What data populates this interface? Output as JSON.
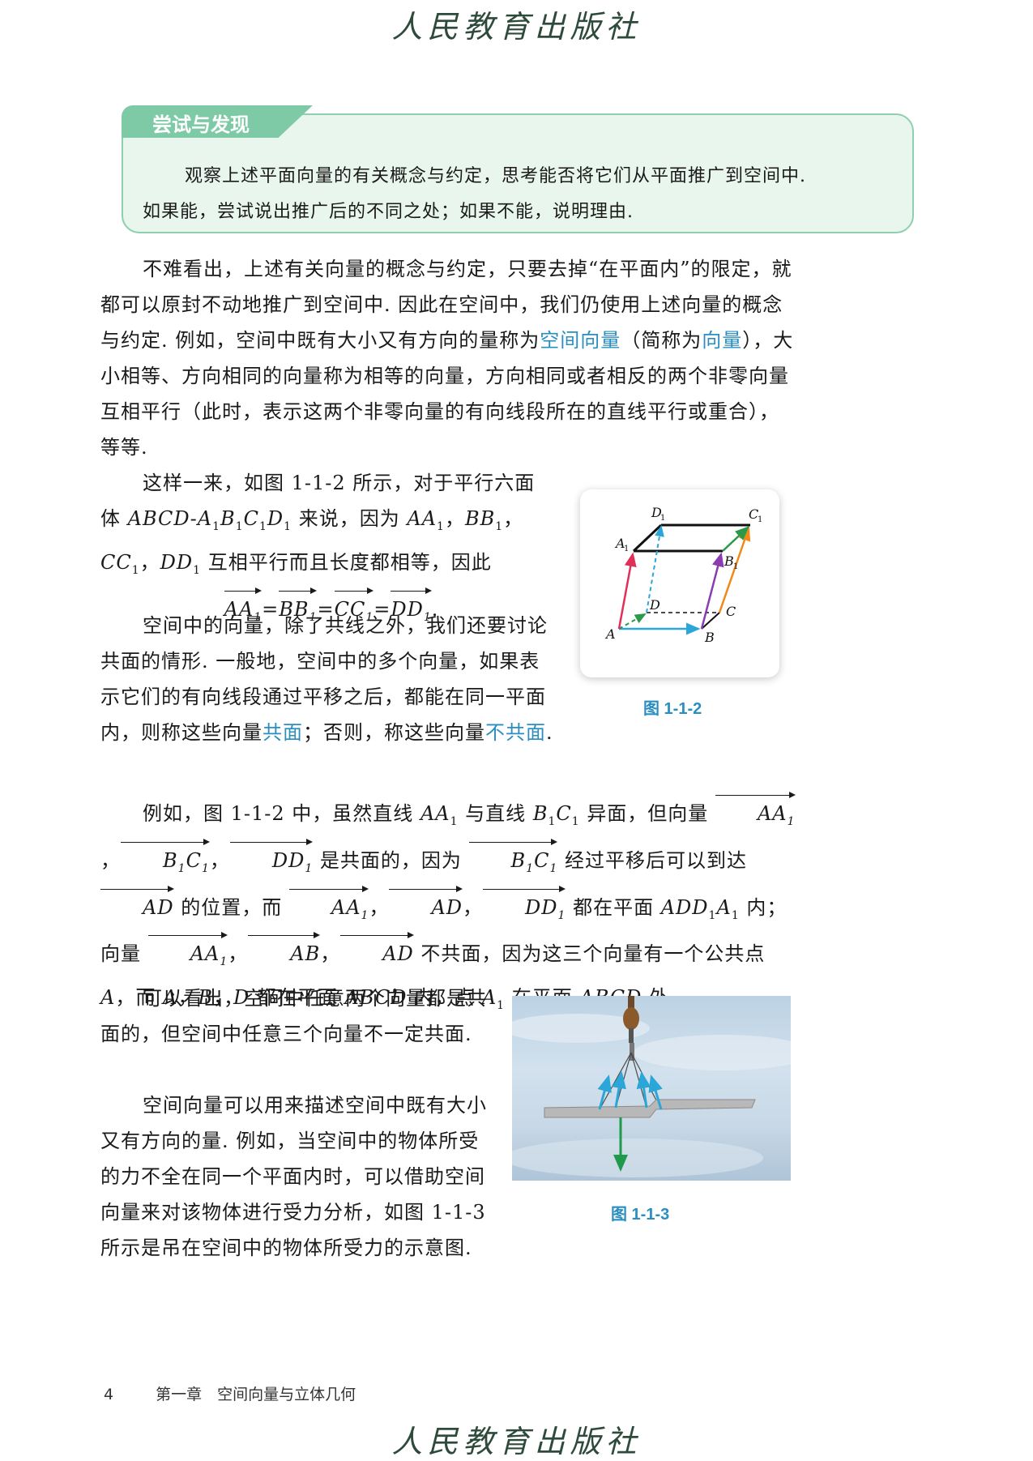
{
  "header": {
    "publisher": "人民教育出版社"
  },
  "tryout": {
    "title": "尝试与发现",
    "line1": "观察上述平面向量的有关概念与约定，思考能否将它们从平面推广到空间中.",
    "line2": "如果能，尝试说出推广后的不同之处；如果不能，说明理由."
  },
  "para1": {
    "a": "不难看出，上述有关向量的概念与约定，只要去掉“在平面内”的限定，就都可以原封不动地推广到空间中. 因此在空间中，我们仍使用上述向量的概念与约定. 例如，空间中既有大小又有方向的量称为",
    "kw1": "空间向量",
    "b": "（简称为",
    "kw2": "向量",
    "c": "），大小相等、方向相同的向量称为相等的向量，方向相同或者相反的两个非零向量互相平行（此时，表示这两个非零向量的有向线段所在的直线平行或重合），等等."
  },
  "para2": {
    "a": "这样一来，如图 1-1-2 所示，对于平行六面体",
    "b": "来说，因为",
    "c": "互相平行而且长度都相等，因此"
  },
  "para3": {
    "a": "空间中的向量，除了共线之外，我们还要讨论共面的情形. 一般地，空间中的多个向量，如果表示它们的有向线段通过平移之后，都能在同一平面内，则称这些向量",
    "kw1": "共面",
    "b": "；否则，称这些向量",
    "kw2": "不共面",
    "c": "."
  },
  "para4": {
    "a": "例如，图 1-1-2 中，虽然直线",
    "b": "与直线",
    "c": "异面，但向量",
    "d": "是共面的，因为",
    "e": "经过平移后可以到达",
    "f": "的位置，而",
    "g": "都在平面",
    "h": "内；向量",
    "i": "不共面，因为这三个向量有一个公共点",
    "j": "，而",
    "k": "都在平面",
    "l": "内，点",
    "m": "在平面",
    "n": "外."
  },
  "para5": {
    "text": "可以看出，空间中任意两个向量都是共面的，但空间中任意三个向量不一定共面."
  },
  "para6": {
    "text": "空间向量可以用来描述空间中既有大小又有方向的量. 例如，当空间中的物体所受的力不全在同一个平面内时，可以借助空间向量来对该物体进行受力分析，如图 1-1-3 所示是吊在空间中的物体所受力的示意图."
  },
  "figure1": {
    "caption": "图 1-1-2",
    "labels": {
      "A": "A",
      "B": "B",
      "C": "C",
      "D": "D",
      "A1": "A",
      "B1": "B",
      "C1": "C",
      "D1": "D",
      "sub": "1"
    }
  },
  "figure2": {
    "caption": "图 1-1-3"
  },
  "footer": {
    "page": "4",
    "chapter": "第一章　空间向量与立体几何"
  },
  "colors": {
    "keyword": "#2a8fc0",
    "tryout_bg": "#e9f6ee",
    "tryout_tab": "#7fcaa6"
  }
}
